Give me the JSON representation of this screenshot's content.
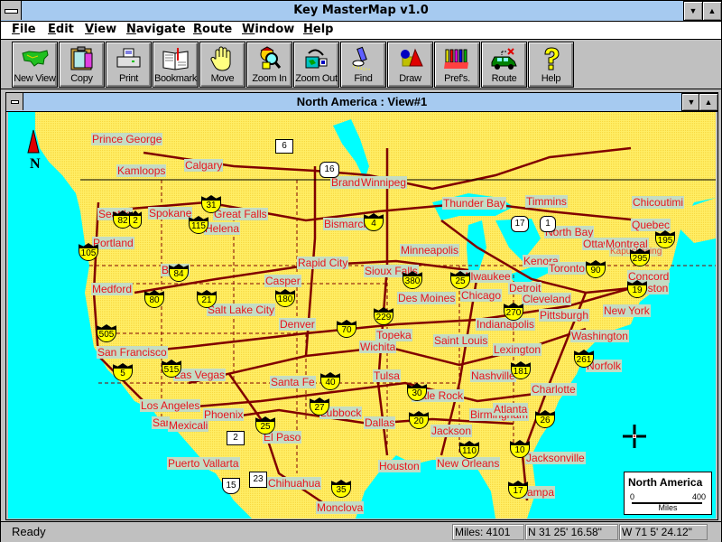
{
  "app": {
    "title": "Key MasterMap v1.0"
  },
  "menu": [
    {
      "label": "File",
      "key": "F",
      "rest": "ile"
    },
    {
      "label": "Edit",
      "key": "E",
      "rest": "dit"
    },
    {
      "label": "View",
      "key": "V",
      "rest": "iew"
    },
    {
      "label": "Navigate",
      "key": "N",
      "rest": "avigate"
    },
    {
      "label": "Route",
      "key": "R",
      "rest": "oute"
    },
    {
      "label": "Window",
      "key": "W",
      "rest": "indow"
    },
    {
      "label": "Help",
      "key": "H",
      "rest": "elp"
    }
  ],
  "toolbar": [
    {
      "label": "New View",
      "icon": "usa-map-icon"
    },
    {
      "label": "Copy",
      "icon": "clipboard-icon"
    },
    {
      "label": "Print",
      "icon": "printer-icon"
    },
    {
      "label": "Bookmark",
      "icon": "book-icon"
    },
    {
      "label": "Move",
      "icon": "hand-icon"
    },
    {
      "label": "Zoom In",
      "icon": "magnifier-character-icon"
    },
    {
      "label": "Zoom Out",
      "icon": "zoom-out-map-icon"
    },
    {
      "label": "Find",
      "icon": "flashlight-icon"
    },
    {
      "label": "Draw",
      "icon": "shapes-icon"
    },
    {
      "label": "Pref's.",
      "icon": "pens-icon"
    },
    {
      "label": "Route",
      "icon": "car-icon"
    },
    {
      "label": "Help",
      "icon": "question-mark-icon"
    }
  ],
  "child_window": {
    "title": "North America : View#1"
  },
  "map": {
    "colors": {
      "water": "#00ffff",
      "land": "#ffee66",
      "roads": "#800000",
      "city_text": "#e8141c",
      "city_bg": "#c4dcc4"
    },
    "compass_label": "N",
    "cities": [
      "Prince George",
      "Kamloops",
      "Calgary",
      "Brand",
      "Winnipeg",
      "Seattle",
      "Spokane",
      "Great Falls",
      "Helena",
      "Portland",
      "Boise",
      "Medford",
      "Bismarck",
      "Rapid City",
      "Casper",
      "Sioux Falls",
      "Minneapolis",
      "Thunder Bay",
      "Timmins",
      "Chicoutimi",
      "Quebec",
      "North Bay",
      "Ottawa",
      "Montreal",
      "Kapuskasing",
      "Kenora",
      "Toronto",
      "Concord",
      "Boston",
      "Milwaukee",
      "Detroit",
      "Chicago",
      "Des Moines",
      "Cleveland",
      "Pittsburgh",
      "New York",
      "Salt Lake City",
      "Denver",
      "Indianapolis",
      "Washington",
      "San Francisco",
      "Topeka",
      "Saint Louis",
      "Lexington",
      "Wichita",
      "Norfolk",
      "Las Vegas",
      "Tulsa",
      "Nashville",
      "Santa Fe",
      "Little Rock",
      "Charlotte",
      "Los Angeles",
      "Phoenix",
      "Lubbock",
      "Birmingham",
      "Atlanta",
      "San Diego",
      "Mexicali",
      "Dallas",
      "El Paso",
      "Jackson",
      "Jacksonville",
      "Houston",
      "New Orleans",
      "Puerto Vallarta",
      "Chihuahua",
      "Tampa",
      "Monclova"
    ],
    "highway_shields": [
      "82",
      "2",
      "31",
      "115",
      "105",
      "84",
      "4",
      "380",
      "80",
      "21",
      "180",
      "505",
      "229",
      "70",
      "515",
      "5",
      "40",
      "27",
      "25",
      "30",
      "20",
      "110",
      "10",
      "26",
      "17",
      "35",
      "270",
      "181",
      "261",
      "25",
      "195",
      "295",
      "19",
      "90"
    ],
    "route_boxes": [
      "6",
      "2",
      "23"
    ],
    "provincial_markers": [
      "16",
      "17",
      "1",
      "15"
    ],
    "scale_legend": {
      "title": "North America",
      "min": "0",
      "max": "400",
      "unit": "Miles"
    }
  },
  "status": {
    "text": "Ready",
    "miles": "Miles:  4101",
    "latitude": "N 31 25' 16.58\"",
    "longitude": "W 71 5' 24.12\""
  }
}
